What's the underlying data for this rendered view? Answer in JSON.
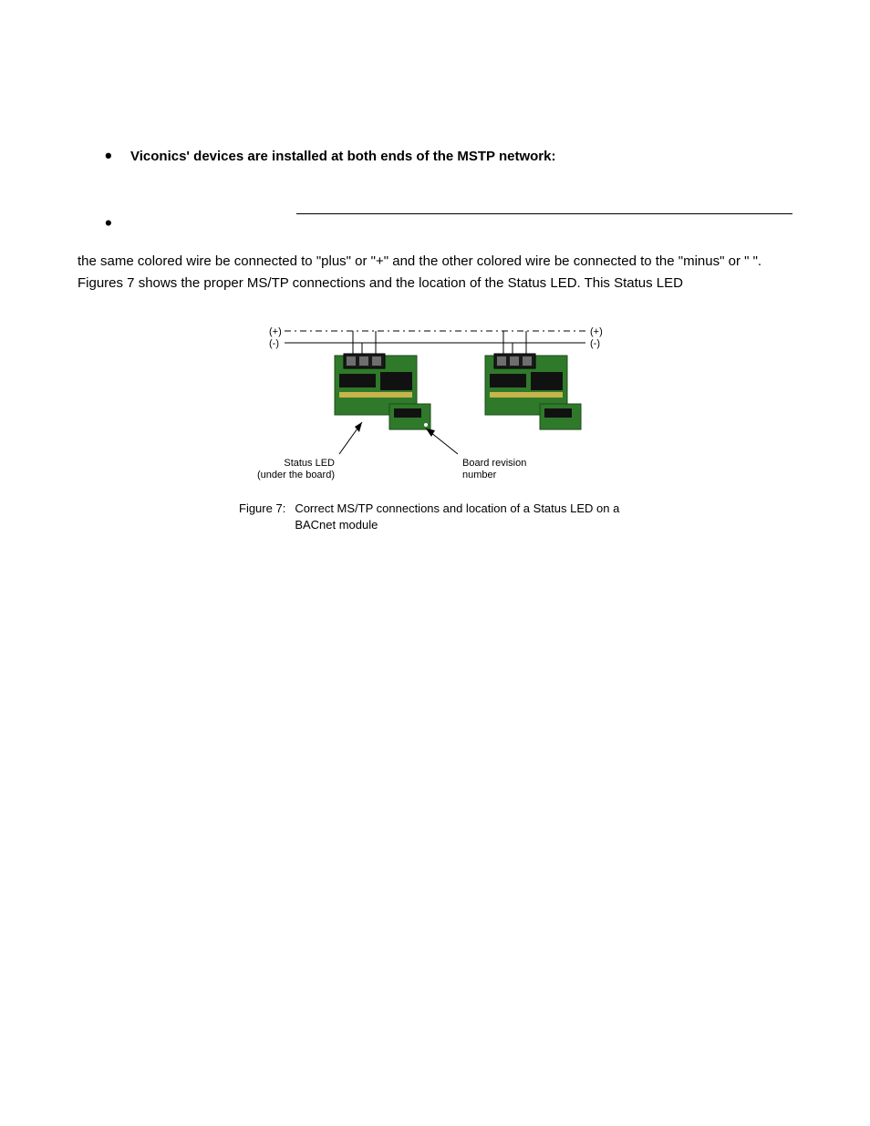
{
  "bullets": [
    {
      "text": "Viconics' devices are installed at both ends of the MSTP network:",
      "bold": true
    },
    {
      "text": "",
      "bold": false
    },
    {
      "text": "",
      "bold": false
    }
  ],
  "paragraph": "the same colored wire be connected to \"plus\" or \"+\" and the other colored wire be connected to the \"minus\" or \" \". Figures 7 shows the proper MS/TP connections and the location of the Status LED. This Status LED",
  "figure": {
    "plus_label": "(+)",
    "minus_label": "(-)",
    "status_led_label_line1": "Status LED",
    "status_led_label_line2": "(under the board)",
    "board_rev_label_line1": "Board revision",
    "board_rev_label_line2": "number",
    "caption_label": "Figure 7:",
    "caption_text": "Correct MS/TP connections and location of a Status LED on a BACnet module"
  }
}
